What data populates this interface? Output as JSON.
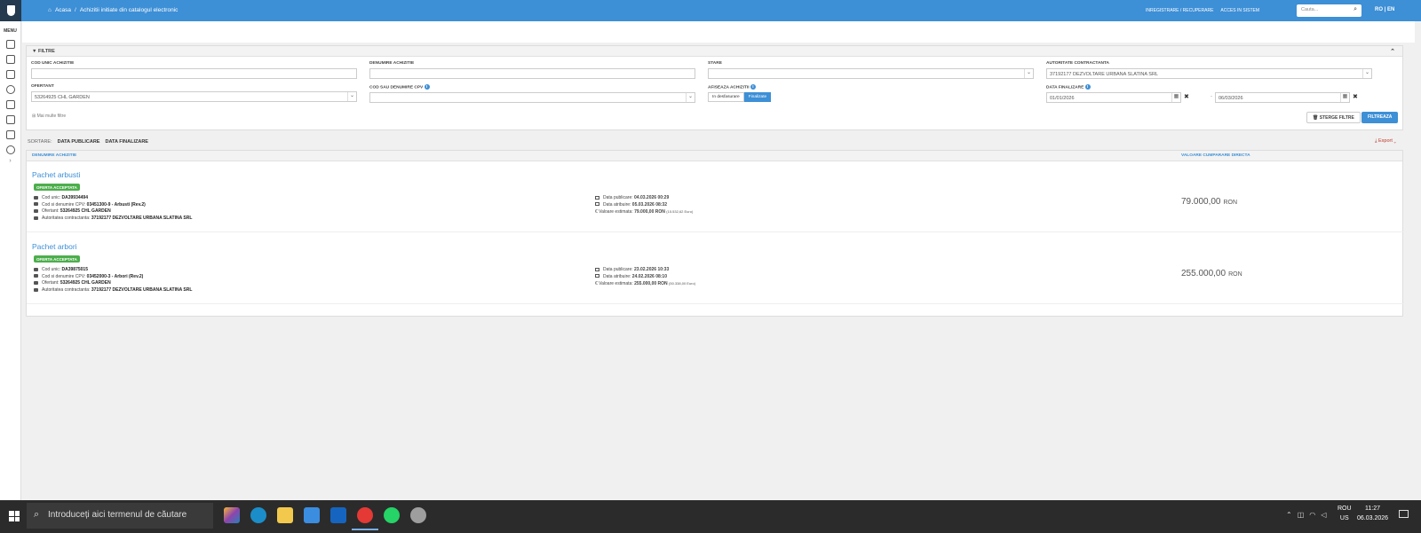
{
  "topbar": {
    "breadcrumb": [
      "Acasa",
      "Achizitii initiate din catalogul electronic"
    ],
    "register_link": "INREGISTRARE / RECUPERARE",
    "access_link": "ACCES IN SISTEM",
    "search_placeholder": "Cauta...",
    "lang": "RO | EN"
  },
  "rail": {
    "menu_label": "MENU"
  },
  "filters": {
    "title": "FILTRE",
    "cod_unic_label": "COD UNIC ACHIZITIE",
    "cod_unic_value": "",
    "denumire_label": "DENUMIRE ACHIZITIE",
    "denumire_value": "",
    "stare_label": "STARE",
    "stare_value": "",
    "autoritate_label": "AUTORITATE CONTRACTANTA",
    "autoritate_value": "37192177 DEZVOLTARE URBANA SLATINA SRL",
    "ofertant_label": "OFERTANT",
    "ofertant_value": "53264925 CHL GARDEN",
    "cpv_label": "COD SAU DENUMIRE CPV",
    "cpv_value": "",
    "afiseaza_label": "AFISEAZA ACHIZITII",
    "afiseaza_options": [
      "In desfasurare",
      "Finalizate"
    ],
    "afiseaza_selected": "Finalizate",
    "data_label": "DATA FINALIZARE",
    "date_from": "01/01/2026",
    "date_to": "06/03/2026",
    "date_sep": "-",
    "more_filters": "Mai multe filtre",
    "clear_label": "STERGE FILTRE",
    "filter_label": "FILTREAZA"
  },
  "sorting": {
    "label": "SORTARE:",
    "options": [
      "DATA PUBLICARE",
      "DATA FINALIZARE"
    ],
    "export_label": "Export"
  },
  "results": {
    "columns": [
      "DENUMIRE ACHIZITIE",
      "VALOARE CUMPARARE DIRECTA"
    ],
    "items": [
      {
        "title": "Pachet arbusti",
        "status": "OFERTA ACCEPTATA",
        "cod_unic_label": "Cod unic:",
        "cod_unic": "DA39934494",
        "cpv_label": "Cod si denumire CPV:",
        "cpv": "03451300-9 - Arbusti (Rev.2)",
        "ofertant_label": "Ofertant:",
        "ofertant": "53264925 CHL GARDEN",
        "autoritate_label": "Autoritatea contractanta:",
        "autoritate": "37192177 DEZVOLTARE URBANA SLATINA SRL",
        "data_publicare_label": "Data publicare:",
        "data_publicare": "04.03.2026 00:29",
        "data_atribuire_label": "Data atribuire:",
        "data_atribuire": "05.03.2026 08:32",
        "valoare_label": "Valoare estimata:",
        "valoare": "79.000,00",
        "valoare_currency": "RON",
        "valoare_eur": "(15.532,62 Euro)",
        "price": "79.000,00",
        "price_currency": "RON"
      },
      {
        "title": "Pachet arbori",
        "status": "OFERTA ACCEPTATA",
        "cod_unic_label": "Cod unic:",
        "cod_unic": "DA39875015",
        "cpv_label": "Cod si denumire CPV:",
        "cpv": "03452000-3 - Arbori (Rev.2)",
        "ofertant_label": "Ofertant:",
        "ofertant": "53264925 CHL GARDEN",
        "autoritate_label": "Autoritatea contractanta:",
        "autoritate": "37192177 DEZVOLTARE URBANA SLATINA SRL",
        "data_publicare_label": "Data publicare:",
        "data_publicare": "23.02.2026 10:33",
        "data_atribuire_label": "Data atribuire:",
        "data_atribuire": "24.02.2026 08:10",
        "valoare_label": "Valoare estimata:",
        "valoare": "255.000,00",
        "valoare_currency": "RON",
        "valoare_eur": "(50.338,00 Euro)",
        "price": "255.000,00",
        "price_currency": "RON"
      }
    ]
  },
  "taskbar": {
    "search_placeholder": "Introduceți aici termenul de căutare",
    "lang_top": "ROU",
    "lang_bottom": "US",
    "time": "11:27",
    "date": "06.03.2026"
  },
  "colors": {
    "accent": "#3d8fd6",
    "success": "#4cae4c",
    "taskbar": "#2b2b2b"
  }
}
